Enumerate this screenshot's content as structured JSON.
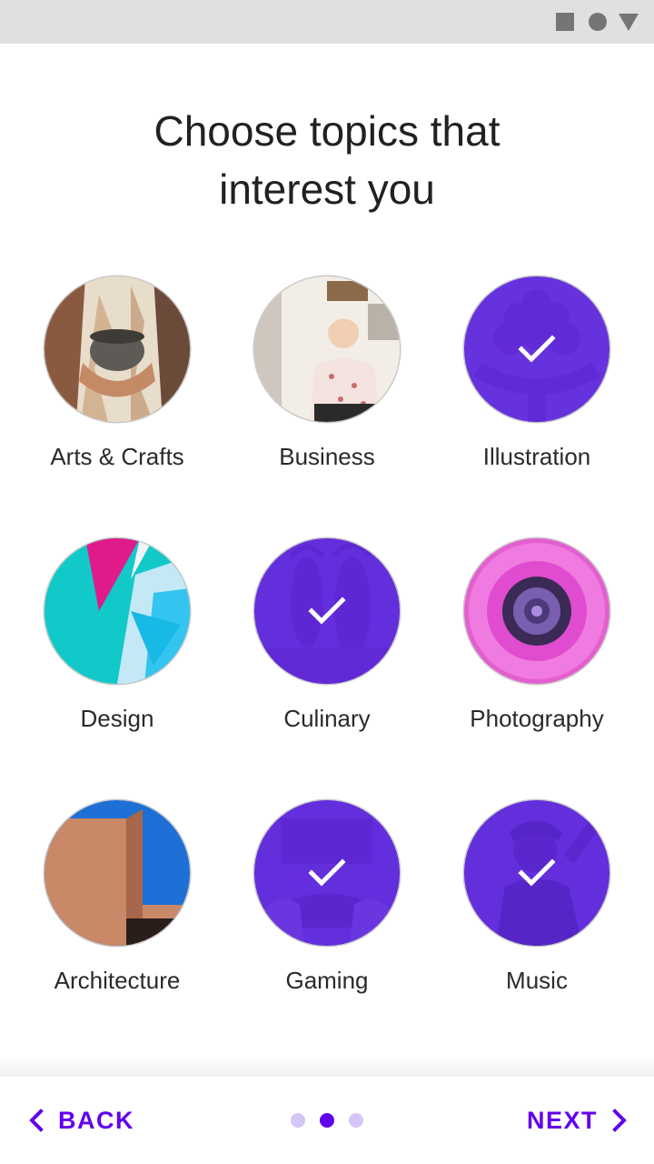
{
  "status_bar": {
    "icons": [
      "square-icon",
      "circle-icon",
      "triangle-icon"
    ]
  },
  "title": {
    "line1": "Choose topics that",
    "line2": "interest you"
  },
  "topics": [
    {
      "label": "Arts & Crafts",
      "selected": false,
      "icon": "pottery-photo"
    },
    {
      "label": "Business",
      "selected": false,
      "icon": "business-woman-photo"
    },
    {
      "label": "Illustration",
      "selected": true,
      "icon": "illustration-art"
    },
    {
      "label": "Design",
      "selected": false,
      "icon": "design-shapes"
    },
    {
      "label": "Culinary",
      "selected": true,
      "icon": "lobster-photo"
    },
    {
      "label": "Photography",
      "selected": false,
      "icon": "flower-photo"
    },
    {
      "label": "Architecture",
      "selected": false,
      "icon": "building-photo"
    },
    {
      "label": "Gaming",
      "selected": true,
      "icon": "gamepad-photo"
    },
    {
      "label": "Music",
      "selected": true,
      "icon": "musician-photo"
    }
  ],
  "footer": {
    "back_label": "BACK",
    "next_label": "NEXT",
    "page_indicator": {
      "total": 3,
      "current": 2
    }
  },
  "colors": {
    "accent": "#6200ee",
    "selected_overlay": "#622adc",
    "status_bar": "#e0e0e0"
  }
}
